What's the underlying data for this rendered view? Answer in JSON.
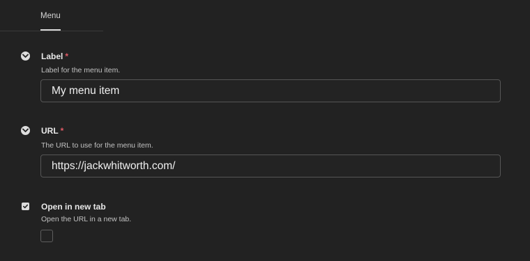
{
  "tabs": [
    {
      "label": "Menu",
      "active": true
    }
  ],
  "fields": {
    "label": {
      "title": "Label",
      "required_mark": "*",
      "help": "Label for the menu item.",
      "value": "My menu item"
    },
    "url": {
      "title": "URL",
      "required_mark": "*",
      "help": "The URL to use for the menu item.",
      "value": "https://jackwhitworth.com/"
    },
    "new_tab": {
      "title": "Open in new tab",
      "help": "Open the URL in a new tab.",
      "checked": false
    }
  },
  "icons": {
    "label_toggle": "chevron-down-icon",
    "url_toggle": "chevron-down-icon",
    "new_tab_toggle": "checkmark-icon"
  },
  "colors": {
    "background": "#222222",
    "required": "#e05a66",
    "input_border": "#565656"
  }
}
